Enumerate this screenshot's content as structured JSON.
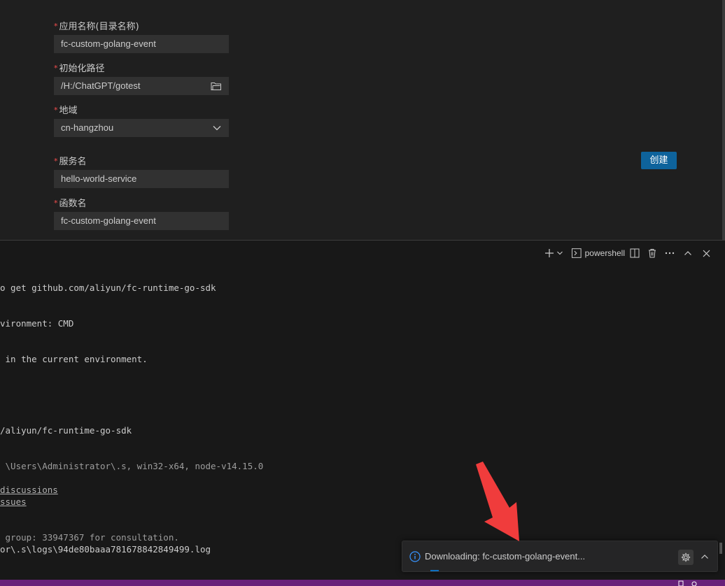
{
  "form": {
    "app_name": {
      "label": "应用名称(目录名称)",
      "value": "fc-custom-golang-event"
    },
    "init_path": {
      "label": "初始化路径",
      "value": "/H:/ChatGPT/gotest"
    },
    "region": {
      "label": "地域",
      "value": "cn-hangzhou"
    },
    "service_name": {
      "label": "服务名",
      "value": "hello-world-service"
    },
    "function_name": {
      "label": "函数名",
      "value": "fc-custom-golang-event"
    },
    "required_mark": "*",
    "create_label": "创建"
  },
  "terminal": {
    "shell_label": "powershell",
    "lines": [
      "o get github.com/aliyun/fc-runtime-go-sdk",
      "vironment: CMD",
      " in the current environment.",
      "/aliyun/fc-runtime-go-sdk",
      " \\Users\\Administrator\\.s, win32-x64, node-v14.15.0",
      "discussions",
      "ssues",
      " group: 33947367 for consultation.",
      "or\\.s\\logs\\94de80baaa781678842849499.log"
    ]
  },
  "notification": {
    "message": "Downloading: fc-custom-golang-event..."
  },
  "colors": {
    "accent_button": "#0e639c",
    "status_bar": "#68217a",
    "arrow": "#f03c3c",
    "required": "#f14c4c"
  }
}
